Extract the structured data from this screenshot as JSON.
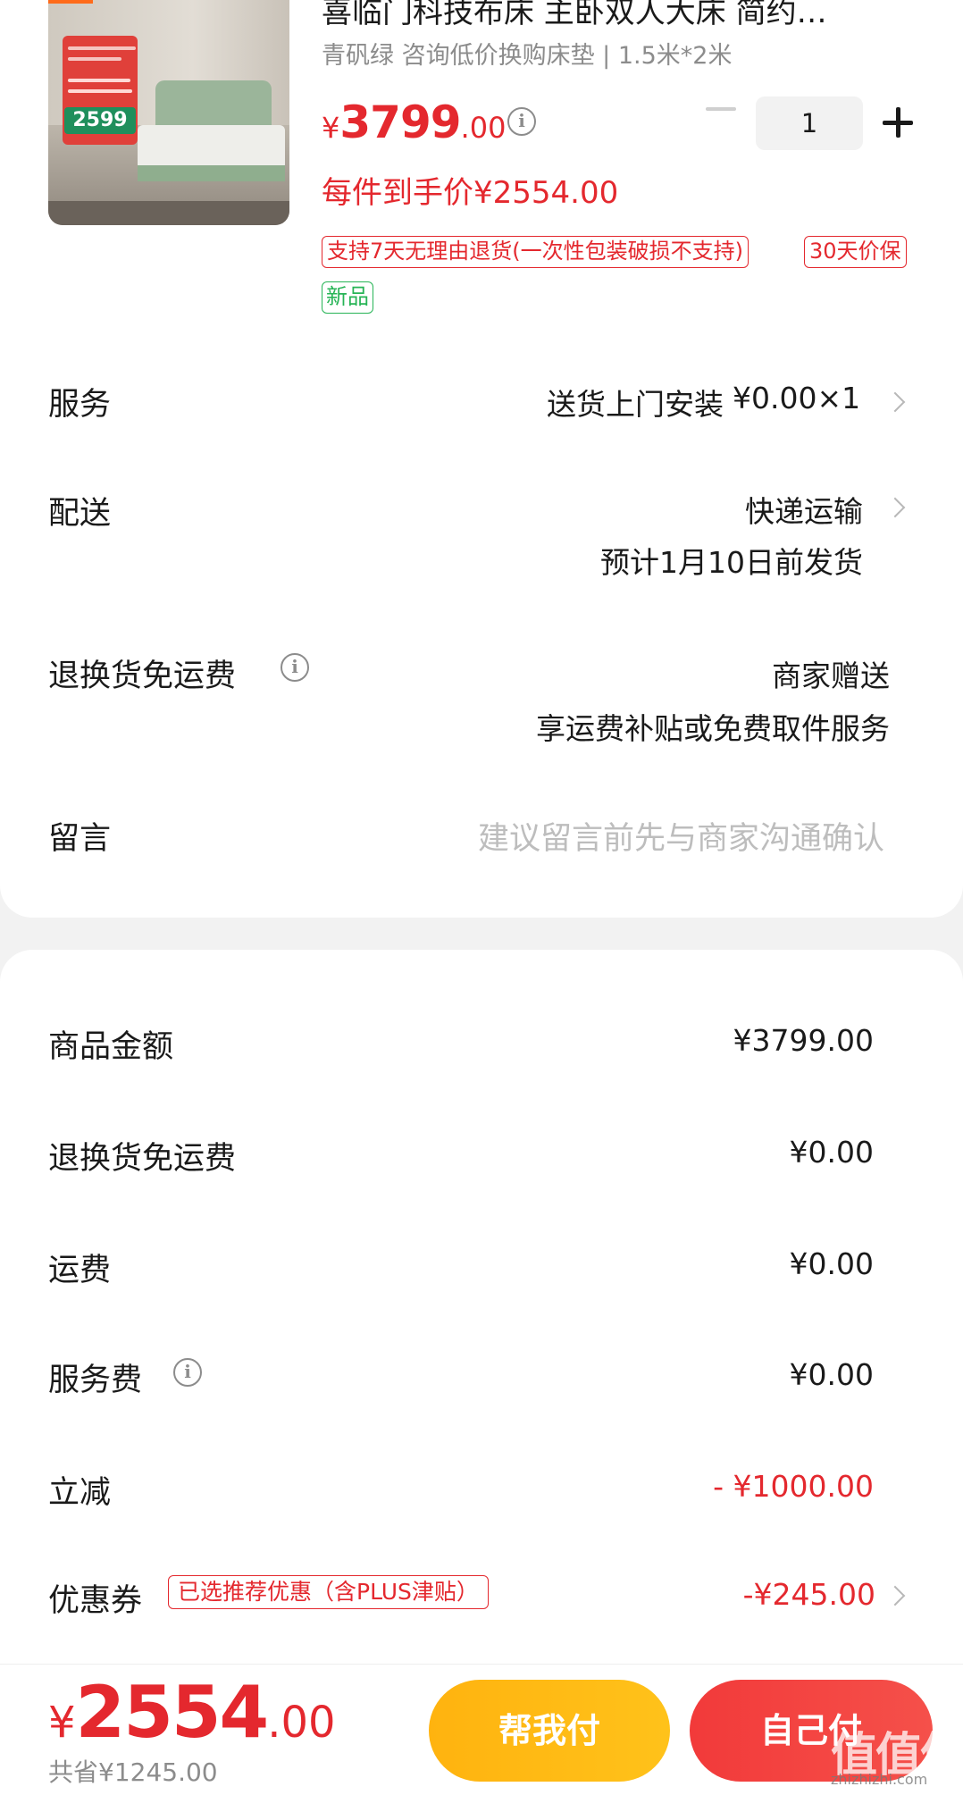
{
  "product": {
    "title": "喜临门科技布床 主卧双人大床 简约…",
    "spec": "青矾绿 咨询低价换购床垫 | 1.5米*2米",
    "image_text": "2599",
    "price_yen": "¥",
    "price_int": "3799",
    "price_dec": ".00",
    "quantity": "1",
    "final_price": "每件到手价¥2554.00",
    "tags": [
      "支持7天无理由退货(一次性包装破损不支持)",
      "30天价保"
    ],
    "new_tag": "新品"
  },
  "rows": {
    "service_label": "服务",
    "service_value": "送货上门安装",
    "service_price": "¥0.00×1",
    "delivery_label": "配送",
    "delivery_value": "快递运输",
    "delivery_eta": "预计1月10日前发货",
    "return_label": "退换货免运费",
    "return_value": "商家赠送",
    "return_desc": "享运费补贴或免费取件服务",
    "message_label": "留言",
    "message_placeholder": "建议留言前先与商家沟通确认"
  },
  "summary": {
    "goods_label": "商品金额",
    "goods_value": "¥3799.00",
    "return_label": "退换货免运费",
    "return_value": "¥0.00",
    "shipping_label": "运费",
    "shipping_value": "¥0.00",
    "service_label": "服务费",
    "service_value": "¥0.00",
    "discount_label": "立减",
    "discount_value": "- ¥1000.00",
    "coupon_label": "优惠券",
    "coupon_tag": "已选推荐优惠（含PLUS津贴）",
    "coupon_value": "-¥245.00"
  },
  "bottom": {
    "total_yen": "¥",
    "total_int": "2554",
    "total_dec": ".00",
    "saved": "共省¥1245.00",
    "help_pay": "帮我付",
    "self_pay": "自己付",
    "watermark": "值值值",
    "watermark_url": "zhizhizhi.com"
  },
  "colors": {
    "accent_red": "#e4282e",
    "accent_orange": "#ffb30f",
    "tag_green": "#27b456"
  },
  "icons": [
    "info-icon",
    "chevron-right-icon",
    "minus-icon",
    "plus-icon"
  ]
}
